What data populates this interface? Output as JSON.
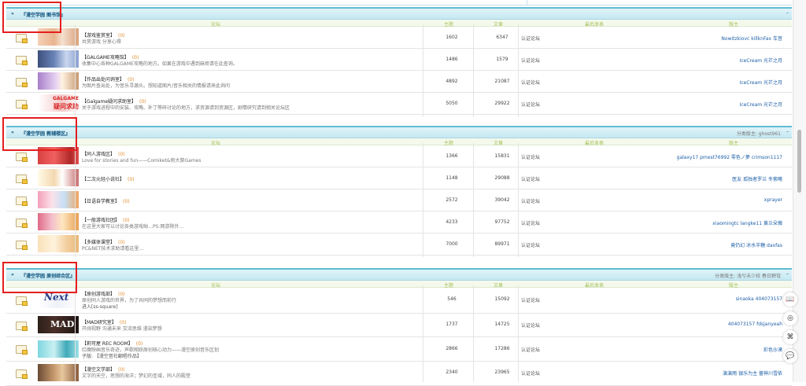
{
  "columns": {
    "forum": "论坛",
    "topics": "主题",
    "posts": "文章",
    "last": "最后发表",
    "moderators": "版主"
  },
  "sections": [
    {
      "title": "『漫空学园 图书馆』",
      "mods": "",
      "forums": [
        {
          "name": "【游戏鉴赏室】",
          "count": "(0)",
          "desc": "共赏游戏 分享心得",
          "extra": "",
          "topics": "1602",
          "posts": "6347",
          "last": "认证论坛",
          "moderators": "Nowitzkiovc killknFax 车音"
        },
        {
          "name": "【GALGAME攻略馆】",
          "count": "(0)",
          "desc": "收集中心各种GALGAME攻略的地方。如果在游戏中遇到麻烦请在此查询。",
          "extra": "",
          "topics": "1486",
          "posts": "1579",
          "last": "认证论坛",
          "moderators": "IceCream 光芒之月"
        },
        {
          "name": "【作品出处问询室】",
          "count": "(0)",
          "desc": "为图片查出处，为音乐寻源头。想知道图片/音乐相关的情报请来此询问",
          "extra": "",
          "topics": "4892",
          "posts": "21087",
          "last": "认证论坛",
          "moderators": "IceCream 光芒之月"
        },
        {
          "name": "【Galgame疑问求助室】",
          "count": "(0)",
          "desc": "关于游戏进程中的安装、攻略、补丁等碎讨论的地方，求资源请到资源区，剧情研究请到相关论坛区",
          "extra": "",
          "topics": "5050",
          "posts": "29922",
          "last": "认证论坛",
          "moderators": "IceCream 光芒之月"
        }
      ]
    },
    {
      "title": "『漫空学园 教辅楼区』",
      "mods": "分类版主: ghost961",
      "forums": [
        {
          "name": "【同人游戏区】",
          "count": "(0)",
          "desc": "Love for stories and fun——Comiket&例大祭Games",
          "extra": "",
          "topics": "1366",
          "posts": "15831",
          "last": "认证论坛",
          "moderators": "galaxy17 pmest76992 零色ノ夢 crimson1117"
        },
        {
          "name": "【二次元轻小说社】",
          "count": "(0)",
          "desc": "",
          "extra": "",
          "topics": "1148",
          "posts": "29088",
          "last": "认证论坛",
          "moderators": "医友 孤独者罗兰 冬紫曦"
        },
        {
          "name": "【日语自学教室】",
          "count": "(0)",
          "desc": "",
          "extra": "",
          "topics": "2572",
          "posts": "39042",
          "last": "认证论坛",
          "moderators": "xprayer"
        },
        {
          "name": "【一般游戏社团】",
          "count": "(0)",
          "desc": "在这里大家可以讨论各类游戏呦…PS:网游除外…",
          "extra": "",
          "topics": "4233",
          "posts": "97752",
          "last": "认证论坛",
          "moderators": "xiaomingtc langke11 黄兰朵薇"
        },
        {
          "name": "【多媒体课堂】",
          "count": "(0)",
          "desc": "PC&NET技术求助请看这里…",
          "extra": "",
          "topics": "7000",
          "posts": "89971",
          "last": "认证论坛",
          "moderators": "竟仍幻 冰水半糖 daxfas"
        }
      ]
    },
    {
      "title": "『漫空学园 原创综合区』",
      "mods": "分类版主: 浅兮未少校 春日野穹",
      "forums": [
        {
          "name": "【原创游戏部】",
          "count": "(0)",
          "desc": "原创同人游戏的世界，为了共同的梦想而前行",
          "extra": "进入[ss-square]",
          "topics": "546",
          "posts": "15092",
          "last": "认证论坛",
          "moderators": "sinaoka 404073157"
        },
        {
          "name": "【MAD研究室】",
          "count": "(0)",
          "desc": "开阔视野 沟通未来 交流思维 漫染梦想",
          "extra": "",
          "topics": "1737",
          "posts": "14725",
          "last": "认证论坛",
          "moderators": "404073157 fdsjanyeah"
        },
        {
          "name": "【莉可屋 REC ROOM】",
          "count": "(0)",
          "desc": "红魔映画音乐奇迹，声歌翔跃原创核心动力——漫空原创音乐区划",
          "extra": "子版: 【漫空音社翻唱作品】",
          "topics": "2866",
          "posts": "17286",
          "last": "认证论坛",
          "moderators": "彩色沙漠"
        },
        {
          "name": "【漫空文学部】",
          "count": "(0)",
          "desc": "文字的天空，思想的海洋；梦幻的圣域，同人的殿堂",
          "extra": "",
          "topics": "2340",
          "posts": "23965",
          "last": "认证论坛",
          "moderators": "演演雨 银乐为主 蔷神川雪依"
        }
      ]
    }
  ],
  "fab_icons": [
    "book-icon",
    "help-icon",
    "qrcode-icon",
    "chat-icon"
  ],
  "fab_glyphs": [
    "📖",
    "◎",
    "⌘",
    "💬"
  ],
  "colors": {
    "accent": "#5fbcd3",
    "title": "#0a4f7a",
    "link": "#1d5fa8",
    "count": "#e08b2c",
    "annotation": "#e41e1e",
    "col_head": "#a4c15a"
  }
}
